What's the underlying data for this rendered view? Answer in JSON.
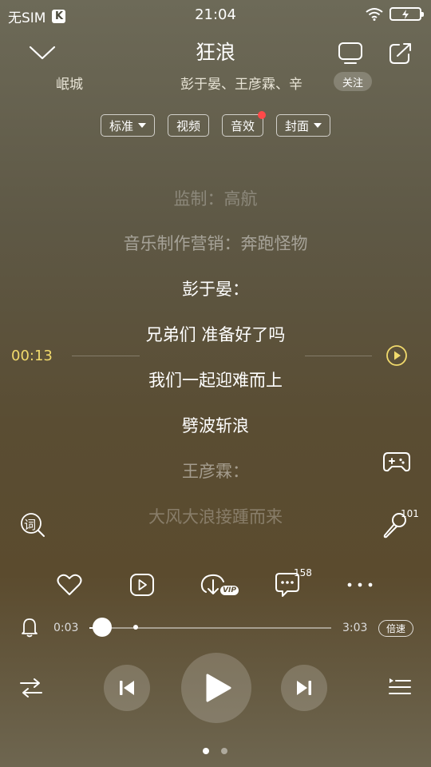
{
  "status_bar": {
    "carrier": "无SIM",
    "carrier_badge": "K",
    "time": "21:04"
  },
  "header": {
    "title": "狂浪",
    "singer_left": "岷城",
    "singers": "彭于晏、王彦霖、辛",
    "follow_label": "关注"
  },
  "tabs": [
    {
      "label": "标准",
      "dropdown": true
    },
    {
      "label": "视频",
      "dropdown": false
    },
    {
      "label": "音效",
      "dropdown": false,
      "badge": true
    },
    {
      "label": "封面",
      "dropdown": true
    }
  ],
  "lyrics": [
    "监制：高航",
    "音乐制作营销：奔跑怪物",
    "彭于晏：",
    "兄弟们 准备好了吗",
    "我们一起迎难而上",
    "劈波斩浪",
    "王彦霖：",
    "大风大浪接踵而来"
  ],
  "lyric_position_time": "00:13",
  "side": {
    "lyric_icon_label": "词",
    "karaoke_count": "101"
  },
  "actions": {
    "comment_count": "158",
    "vip_label": "VIP"
  },
  "progress": {
    "current": "0:03",
    "total": "3:03",
    "fraction": 0.016,
    "speed_label": "倍速"
  },
  "colors": {
    "accent_time": "#f1da6c",
    "badge_red": "#ff4949"
  },
  "pager": {
    "count": 2,
    "active": 0
  }
}
